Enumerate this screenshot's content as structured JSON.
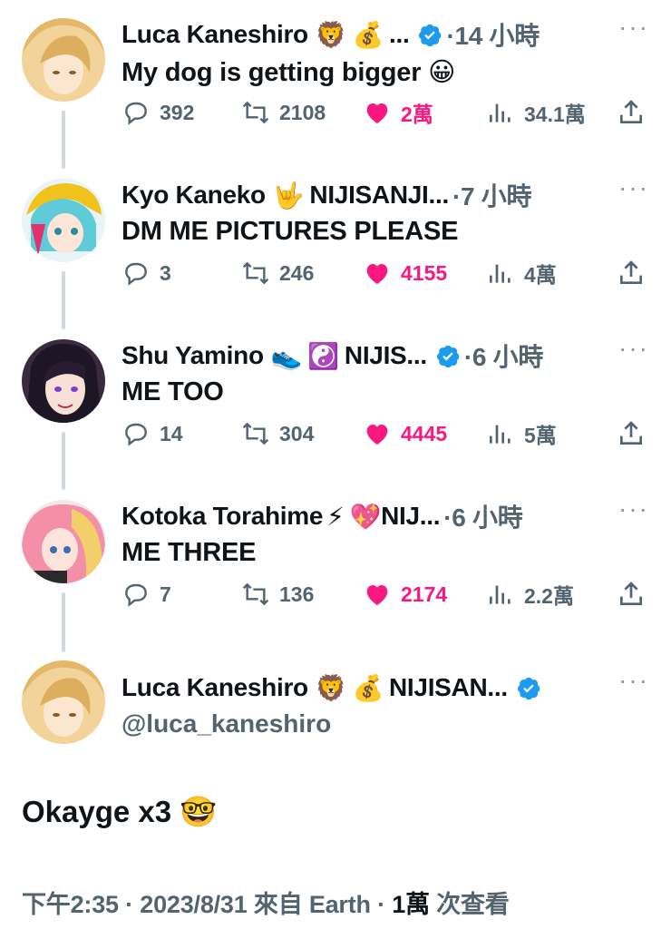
{
  "replies": [
    {
      "name": "Luca Kaneshiro",
      "badges": [
        "🦁",
        "💰"
      ],
      "tag": "...",
      "verified": true,
      "time_prefix": "·",
      "time": "14 小時",
      "text": "My dog is getting bigger 😀",
      "replies_count": "392",
      "retweets": "2108",
      "likes": "2萬",
      "views": "34.1萬",
      "liked": true
    },
    {
      "name": "Kyo Kaneko",
      "badges": [
        "🤟"
      ],
      "tag": "NIJISANJI...",
      "verified": false,
      "time_prefix": "·",
      "time": "7 小時",
      "text": "DM ME PICTURES PLEASE",
      "replies_count": "3",
      "retweets": "246",
      "likes": "4155",
      "views": "4萬",
      "liked": true
    },
    {
      "name": "Shu Yamino",
      "badges": [
        "👟",
        "☯️"
      ],
      "tag": "NIJIS...",
      "verified": true,
      "time_prefix": "·",
      "time": "6 小時",
      "text": "ME TOO",
      "replies_count": "14",
      "retweets": "304",
      "likes": "4445",
      "views": "5萬",
      "liked": true
    },
    {
      "name": "Kotoka Torahime",
      "badges": [
        "⚡",
        "💖"
      ],
      "tag": "NIJ...",
      "verified": false,
      "time_prefix": "·",
      "time": "6 小時",
      "text": "ME THREE",
      "replies_count": "7",
      "retweets": "136",
      "likes": "2174",
      "views": "2.2萬",
      "liked": true
    }
  ],
  "main_tweet": {
    "name": "Luca Kaneshiro",
    "badges": [
      "🦁",
      "💰"
    ],
    "tag": "NIJISAN...",
    "verified": true,
    "handle": "@luca_kaneshiro",
    "text": "Okayge x3 🤓",
    "time": "下午2:35",
    "date": "2023/8/31",
    "source_prefix": "來自",
    "source": "Earth",
    "views": "1萬",
    "views_label": "次查看"
  },
  "icons": {
    "reply": "reply-icon",
    "retweet": "retweet-icon",
    "like": "heart-icon",
    "views": "views-icon",
    "share": "share-icon",
    "more": "more-icon",
    "verified": "verified-badge-icon"
  },
  "colors": {
    "text": "#0f1419",
    "secondary": "#536471",
    "like": "#f91880",
    "verified": "#1d9bf0",
    "thread_line": "#cfd9de"
  }
}
